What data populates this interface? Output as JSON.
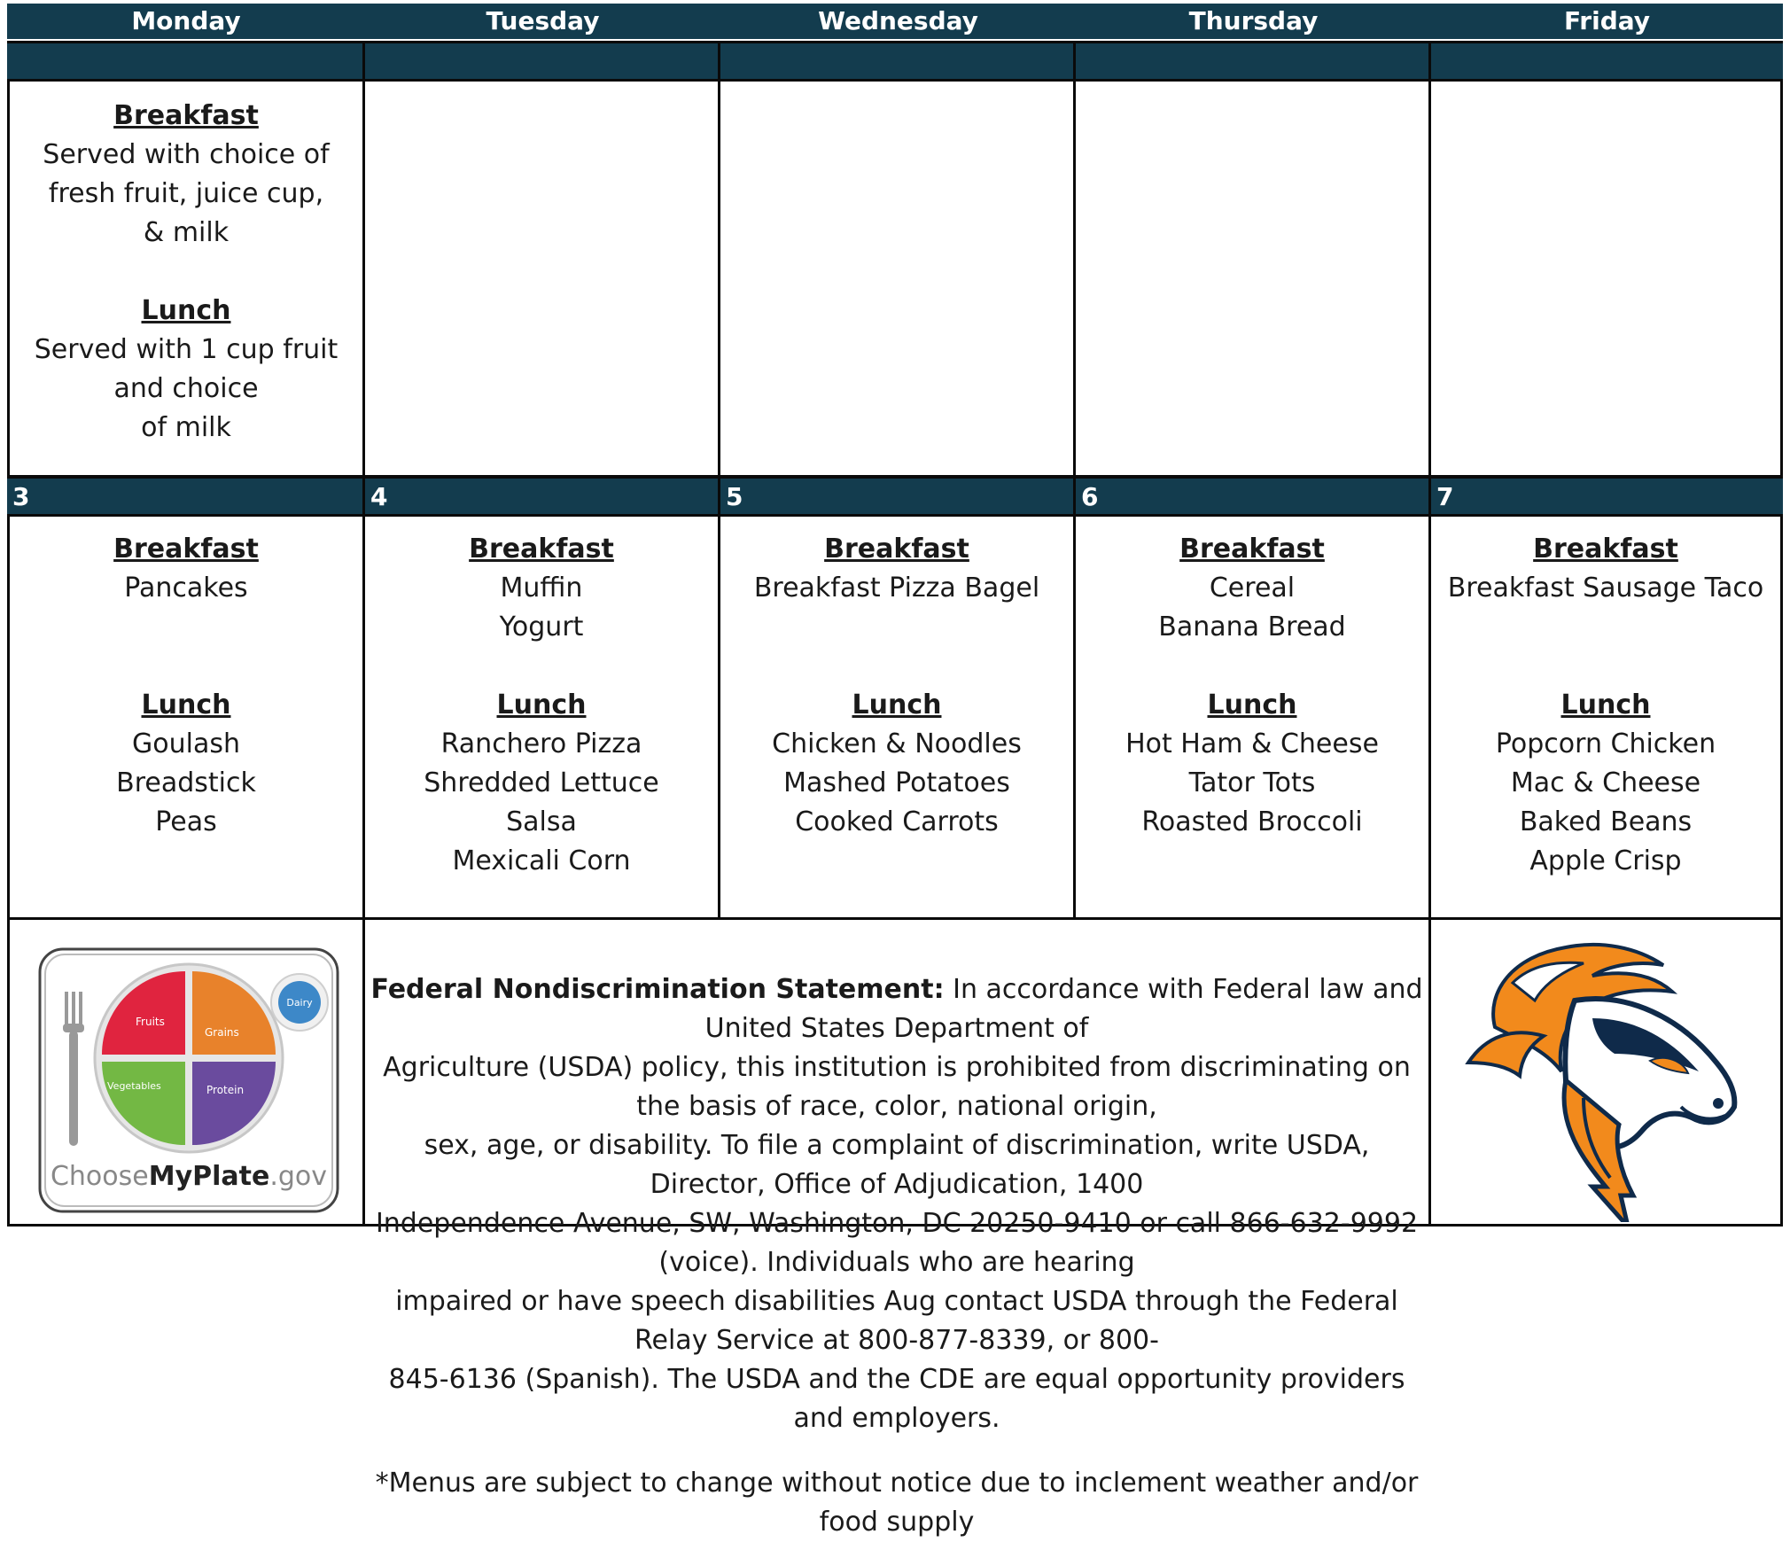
{
  "days": [
    "Monday",
    "Tuesday",
    "Wednesday",
    "Thursday",
    "Friday"
  ],
  "week0": {
    "info": {
      "breakfast_heading": "Breakfast",
      "breakfast_lines": [
        "Served with choice of",
        "fresh fruit, juice cup,",
        "& milk"
      ],
      "lunch_heading": "Lunch",
      "lunch_lines": [
        "Served with 1 cup fruit",
        "and choice",
        "of milk"
      ]
    }
  },
  "week1": {
    "dates": [
      "3",
      "4",
      "5",
      "6",
      "7"
    ],
    "menus": [
      {
        "breakfast_heading": "Breakfast",
        "breakfast": [
          "Pancakes"
        ],
        "lunch_heading": "Lunch",
        "lunch": [
          "Goulash",
          "Breadstick",
          "Peas"
        ]
      },
      {
        "breakfast_heading": "Breakfast",
        "breakfast": [
          "Muffin",
          "Yogurt"
        ],
        "lunch_heading": "Lunch",
        "lunch": [
          "Ranchero Pizza",
          "Shredded Lettuce",
          "Salsa",
          "Mexicali Corn"
        ]
      },
      {
        "breakfast_heading": "Breakfast",
        "breakfast": [
          "Breakfast Pizza Bagel"
        ],
        "lunch_heading": "Lunch",
        "lunch": [
          "Chicken & Noodles",
          "Mashed Potatoes",
          "Cooked Carrots"
        ]
      },
      {
        "breakfast_heading": "Breakfast",
        "breakfast": [
          "Cereal",
          "Banana Bread"
        ],
        "lunch_heading": "Lunch",
        "lunch": [
          "Hot Ham & Cheese",
          "Tator Tots",
          "Roasted Broccoli"
        ]
      },
      {
        "breakfast_heading": "Breakfast",
        "breakfast": [
          "Breakfast Sausage Taco"
        ],
        "lunch_heading": "Lunch",
        "lunch": [
          "Popcorn Chicken",
          "Mac & Cheese",
          "Baked Beans",
          "Apple Crisp"
        ]
      }
    ]
  },
  "footer": {
    "myplate": {
      "fruits": "Fruits",
      "grains": "Grains",
      "vegetables": "Vegetables",
      "protein": "Protein",
      "dairy": "Dairy",
      "brand_prefix": "Choose",
      "brand_bold": "MyPlate",
      "brand_suffix": ".gov"
    },
    "statement_title": "Federal Nondiscrimination Statement:",
    "statement_lines": [
      "In accordance with Federal law and United States Department of",
      "Agriculture (USDA) policy, this institution is prohibited from discriminating on the basis of race, color, national origin,",
      "sex, age, or disability.  To file a complaint of discrimination, write USDA, Director, Office of Adjudication, 1400",
      "Independence Avenue, SW, Washington, DC 20250-9410 or call 866-632-9992 (voice).   Individuals who are hearing",
      "impaired or have speech disabilities Aug contact USDA through the Federal Relay Service at 800-877-8339, or 800-",
      "845-6136 (Spanish).  The USDA and the CDE are equal opportunity providers and employers."
    ],
    "disclaimer": "*Menus are subject to change without notice due to inclement weather and/or food supply"
  }
}
